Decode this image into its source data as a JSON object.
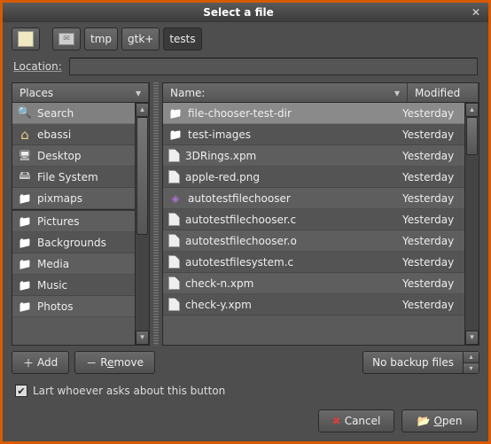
{
  "title": "Select a file",
  "path": {
    "breadcrumbs": [
      "tmp",
      "gtk+",
      "tests"
    ]
  },
  "location": {
    "label": "Location:",
    "value": ""
  },
  "places": {
    "header": "Places",
    "items": [
      {
        "label": "Search",
        "icon": "search-icon",
        "selected": true
      },
      {
        "label": "ebassi",
        "icon": "home-icon"
      },
      {
        "label": "Desktop",
        "icon": "desktop-icon"
      },
      {
        "label": "File System",
        "icon": "drive-icon"
      },
      {
        "label": "pixmaps",
        "icon": "folder-icon"
      }
    ],
    "bookmarks": [
      {
        "label": "Pictures",
        "icon": "folder-icon"
      },
      {
        "label": "Backgrounds",
        "icon": "folder-icon"
      },
      {
        "label": "Media",
        "icon": "folder-icon"
      },
      {
        "label": "Music",
        "icon": "folder-icon"
      },
      {
        "label": "Photos",
        "icon": "folder-icon"
      }
    ]
  },
  "files": {
    "headers": {
      "name": "Name:",
      "modified": "Modified"
    },
    "rows": [
      {
        "name": "file-chooser-test-dir",
        "modified": "Yesterday",
        "icon": "folder-icon",
        "selected": true
      },
      {
        "name": "test-images",
        "modified": "Yesterday",
        "icon": "folder-icon"
      },
      {
        "name": "3DRings.xpm",
        "modified": "Yesterday",
        "icon": "file-icon"
      },
      {
        "name": "apple-red.png",
        "modified": "Yesterday",
        "icon": "file-icon"
      },
      {
        "name": "autotestfilechooser",
        "modified": "Yesterday",
        "icon": "diamond-icon"
      },
      {
        "name": "autotestfilechooser.c",
        "modified": "Yesterday",
        "icon": "file-icon"
      },
      {
        "name": "autotestfilechooser.o",
        "modified": "Yesterday",
        "icon": "file-icon"
      },
      {
        "name": "autotestfilesystem.c",
        "modified": "Yesterday",
        "icon": "file-icon"
      },
      {
        "name": "check-n.xpm",
        "modified": "Yesterday",
        "icon": "file-icon"
      },
      {
        "name": "check-y.xpm",
        "modified": "Yesterday",
        "icon": "file-icon"
      }
    ]
  },
  "buttons": {
    "add": "Add",
    "remove_pre": "R",
    "remove_u": "e",
    "remove_post": "move",
    "filter": "No backup files",
    "cancel": "Cancel",
    "open_u": "O",
    "open_post": "pen"
  },
  "checkbox": {
    "label": "Lart whoever asks about this button",
    "checked": true
  }
}
